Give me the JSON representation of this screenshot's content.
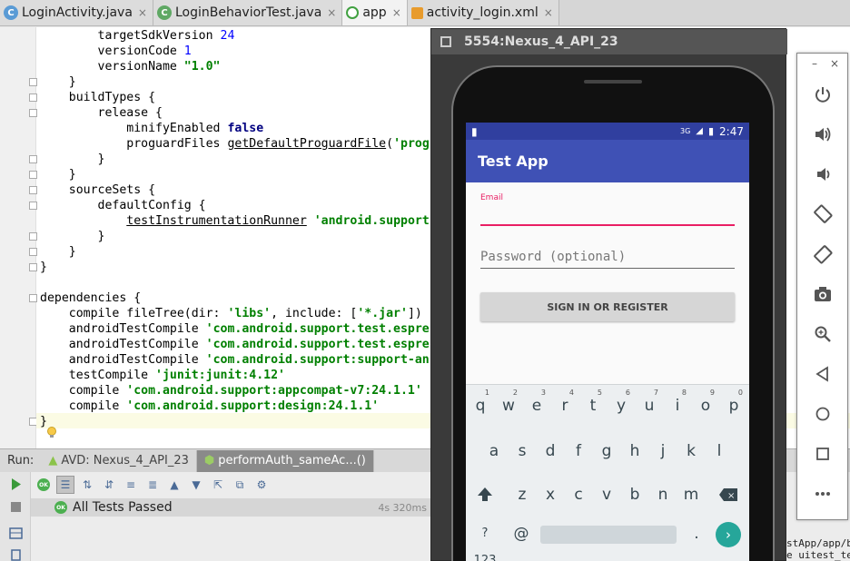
{
  "tabs": [
    {
      "label": "LoginActivity.java",
      "icon": "java-class-icon",
      "active": false
    },
    {
      "label": "LoginBehaviorTest.java",
      "icon": "test-class-icon",
      "active": false
    },
    {
      "label": "app",
      "icon": "gradle-icon",
      "active": true
    },
    {
      "label": "activity_login.xml",
      "icon": "xml-layout-icon",
      "active": false
    }
  ],
  "tab_close_glyph": "×",
  "editor": {
    "lines": [
      "        targetSdkVersion 24",
      "        versionCode 1",
      "        versionName \"1.0\"",
      "    }",
      "    buildTypes {",
      "        release {",
      "            minifyEnabled false",
      "            proguardFiles getDefaultProguardFile('prog",
      "        }",
      "    }",
      "    sourceSets {",
      "        defaultConfig {",
      "            testInstrumentationRunner 'android.support",
      "        }",
      "    }",
      "}",
      "",
      "dependencies {",
      "    compile fileTree(dir: 'libs', include: ['*.jar'])",
      "    androidTestCompile 'com.android.support.test.espre",
      "    androidTestCompile 'com.android.support.test.espre",
      "    androidTestCompile 'com.android.support:support-an",
      "    testCompile 'junit:junit:4.12'",
      "    compile 'com.android.support:appcompat-v7:24.1.1'",
      "    compile 'com.android.support:design:24.1.1'",
      "}"
    ]
  },
  "run_panel": {
    "label": "Run:",
    "tabs": [
      {
        "label": "AVD: Nexus_4_API_23",
        "active": false
      },
      {
        "label": "performAuth_sameAc...()",
        "active": true
      }
    ],
    "result_text": "All Tests Passed",
    "result_badge": "OK",
    "result_time": "4s 320ms"
  },
  "emulator": {
    "title": "5554:Nexus_4_API_23",
    "status_time": "2:47",
    "status_network": "3G",
    "app_title": "Test App",
    "email_label": "Email",
    "password_hint": "Password (optional)",
    "signin_label": "SIGN IN OR REGISTER",
    "keyboard": {
      "row1": [
        "q",
        "w",
        "e",
        "r",
        "t",
        "y",
        "u",
        "i",
        "o",
        "p"
      ],
      "row1_hints": [
        "1",
        "2",
        "3",
        "4",
        "5",
        "6",
        "7",
        "8",
        "9",
        "0"
      ],
      "row2": [
        "a",
        "s",
        "d",
        "f",
        "g",
        "h",
        "j",
        "k",
        "l"
      ],
      "row3": [
        "z",
        "x",
        "c",
        "v",
        "b",
        "n",
        "m"
      ],
      "symbols_key": "?123",
      "at_key": "@",
      "period_key": "."
    }
  },
  "emu_controls": {
    "minimize": "–",
    "close": "×",
    "buttons": [
      "power-icon",
      "volume-up-icon",
      "volume-down-icon",
      "rotate-left-icon",
      "rotate-right-icon",
      "camera-icon",
      "zoom-icon",
      "back-icon",
      "home-icon",
      "overview-icon",
      "more-icon"
    ]
  },
  "background_text": "stApp/app/b\ne uitest_te"
}
